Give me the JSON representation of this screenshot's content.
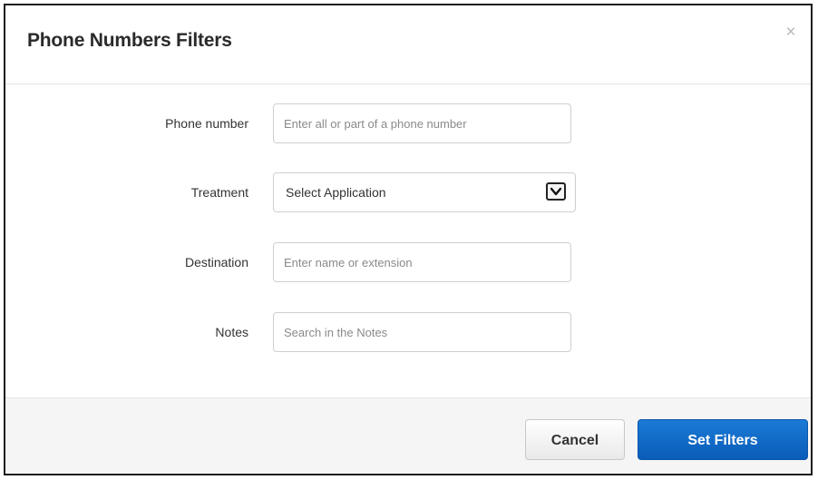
{
  "modal": {
    "title": "Phone Numbers Filters",
    "close_icon": "close-icon",
    "close_glyph": "×"
  },
  "form": {
    "phone_number": {
      "label": "Phone number",
      "value": "",
      "placeholder": "Enter all or part of a phone number"
    },
    "treatment": {
      "label": "Treatment",
      "selected": "Select Application",
      "icon": "chevron-down-icon"
    },
    "destination": {
      "label": "Destination",
      "value": "",
      "placeholder": "Enter name or extension"
    },
    "notes": {
      "label": "Notes",
      "value": "",
      "placeholder": "Search in the Notes"
    }
  },
  "footer": {
    "cancel_label": "Cancel",
    "submit_label": "Set Filters"
  },
  "colors": {
    "primary_button": "#0a66c8",
    "footer_background": "#f5f5f5",
    "title_text": "#2a2a2a"
  }
}
